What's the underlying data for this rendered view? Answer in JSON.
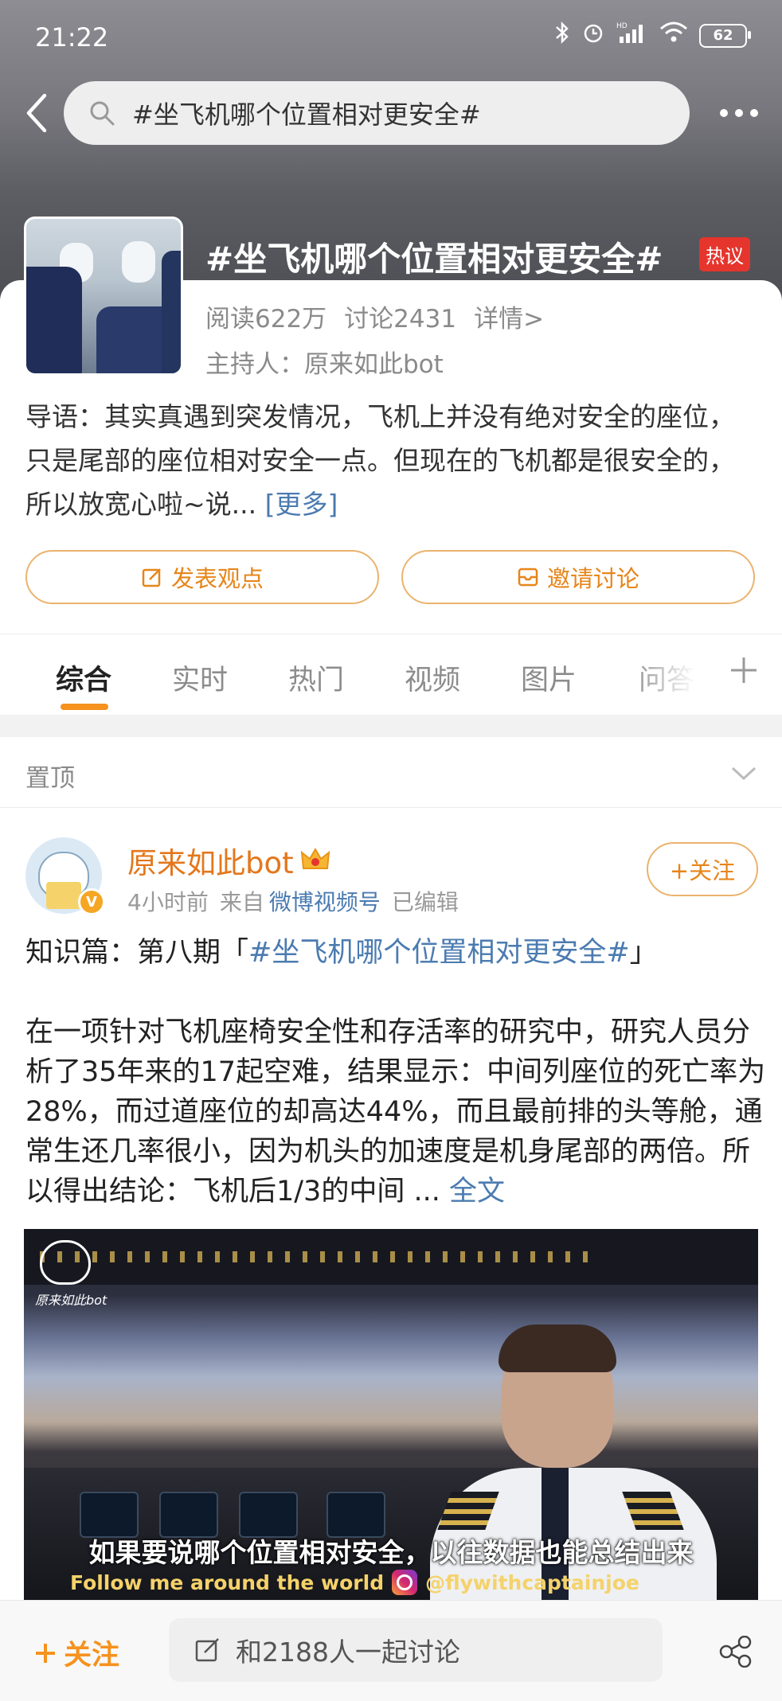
{
  "status_bar": {
    "time": "21:22",
    "battery": "62",
    "hd_label": "HD"
  },
  "search": {
    "query": "#坐飞机哪个位置相对更安全#"
  },
  "topic": {
    "title": "#坐飞机哪个位置相对更安全#",
    "badge": "热议",
    "reads": "阅读622万",
    "discussions": "讨论2431",
    "details_link": "详情>",
    "host": "主持人：原来如此bot",
    "intro": "导语：其实真遇到突发情况，飞机上并没有绝对安全的座位，只是尾部的座位相对安全一点。但现在的飞机都是很安全的，所以放宽心啦~说...",
    "intro_more": "[更多]"
  },
  "actions": {
    "post_opinion": "发表观点",
    "invite_discussion": "邀请讨论"
  },
  "tabs": [
    "综合",
    "实时",
    "热门",
    "视频",
    "图片",
    "问答"
  ],
  "pinned": {
    "label": "置顶"
  },
  "post": {
    "username": "原来如此bot",
    "time": "4小时前",
    "from_label": "来自",
    "source": "微博视频号",
    "edited": "已编辑",
    "follow_button": "+关注",
    "line1_prefix": "知识篇：第八期「",
    "line1_hashtag": "#坐飞机哪个位置相对更安全#",
    "line1_suffix": "」",
    "body": "在一项针对飞机座椅安全性和存活率的研究中，研究人员分析了35年来的17起空难，结果显示：中间列座位的死亡率为28%，而过道座位的却高达44%，而且最前排的头等舱，通常生还几率很小，因为机头的加速度是机身尾部的两倍。所以得出结论：飞机后1/3的中间 ...",
    "full_text": "全文"
  },
  "video": {
    "logo_text": "原来如此bot",
    "subtitle": "如果要说哪个位置相对安全，以往数据也能总结出来",
    "follow_line": "Follow me around the world",
    "handle": "@flywithcaptainjoe"
  },
  "bottom_bar": {
    "follow": "关注",
    "discuss_placeholder": "和2188人一起讨论"
  },
  "colors": {
    "accent": "#f6921e",
    "link": "#4b7bb0",
    "hot_badge": "#e5352d"
  }
}
